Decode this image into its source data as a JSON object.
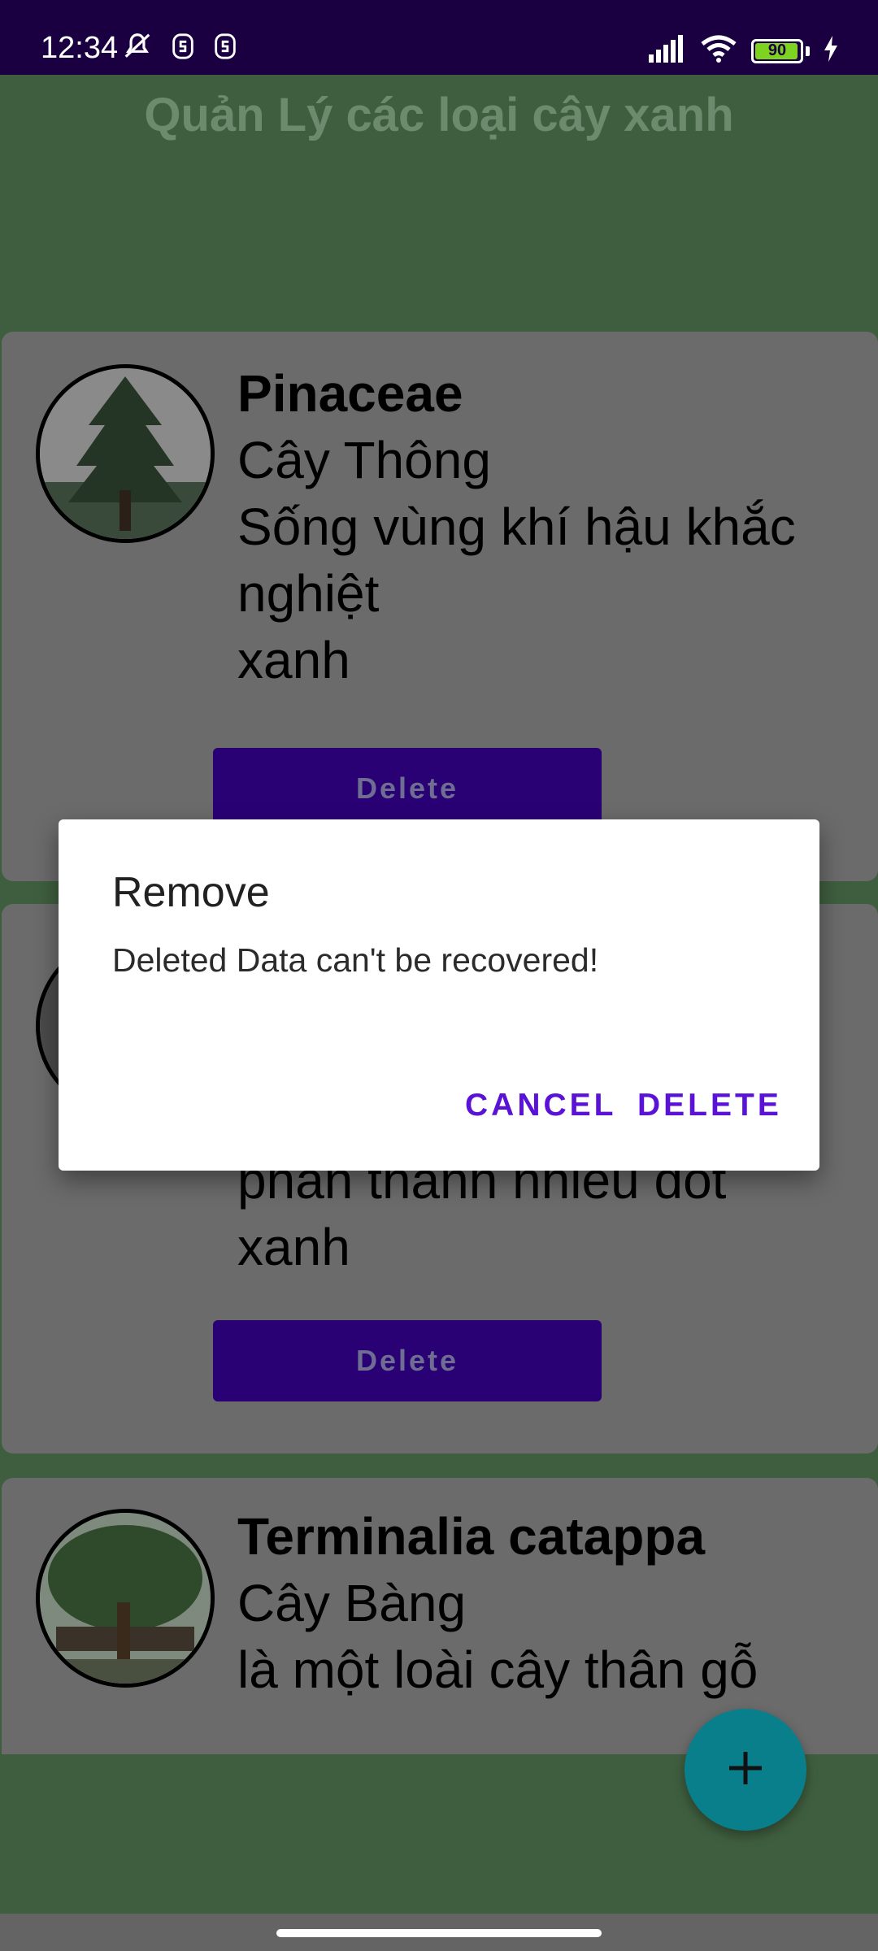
{
  "status_bar": {
    "time": "12:34",
    "battery": "90",
    "icons": [
      "mute-bell-icon",
      "notification-s-icon",
      "notification-s-icon",
      "signal-icon",
      "wifi-icon",
      "battery-icon",
      "charging-icon"
    ]
  },
  "app": {
    "title": "Quản Lý các loại cây xanh"
  },
  "cards": [
    {
      "scientific_name": "Pinaceae",
      "common_name": "Cây Thông",
      "description": "Sống vùng khí hậu khắc nghiệt",
      "color": "xanh",
      "delete_label": "Delete"
    },
    {
      "description_partial_1": "phân thành nhiều đốt",
      "color": "xanh",
      "delete_label": "Delete"
    },
    {
      "scientific_name": "Terminalia catappa",
      "common_name": "Cây Bàng",
      "description": "là một loài cây thân gỗ"
    }
  ],
  "dialog": {
    "title": "Remove",
    "message": "Deleted Data can't be recovered!",
    "cancel_label": "CANCEL",
    "delete_label": "DELETE"
  },
  "fab": {
    "icon": "plus-icon"
  },
  "colors": {
    "status_bar": "#1a0040",
    "header": "#3f5e3f",
    "delete_button": "#2a0075",
    "dialog_action": "#5a12d6",
    "fab": "#0a7f8c"
  }
}
